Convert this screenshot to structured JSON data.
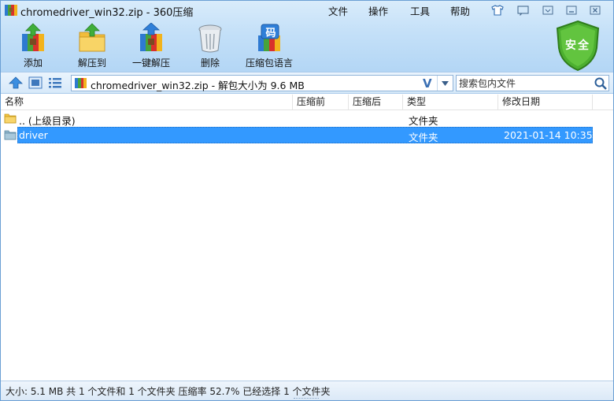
{
  "window": {
    "title": "chromedriver_win32.zip - 360压缩"
  },
  "menu": {
    "items": [
      "文件",
      "操作",
      "工具",
      "帮助"
    ]
  },
  "toolbar": {
    "buttons": [
      {
        "label": "添加",
        "icon": "add-archive-icon"
      },
      {
        "label": "解压到",
        "icon": "extract-to-icon"
      },
      {
        "label": "一键解压",
        "icon": "one-click-extract-icon"
      },
      {
        "label": "删除",
        "icon": "delete-trash-icon"
      },
      {
        "label": "压缩包语言",
        "icon": "archive-language-icon"
      }
    ],
    "language_glyph": "码",
    "security_badge": "安全"
  },
  "address": {
    "path": "chromedriver_win32.zip - 解包大小为 9.6 MB",
    "verify_glyph": "V",
    "search_placeholder": "搜索包内文件"
  },
  "columns": [
    "名称",
    "压缩前",
    "压缩后",
    "类型",
    "修改日期"
  ],
  "rows": [
    {
      "name": ".. (上级目录)",
      "before": "",
      "after": "",
      "type": "文件夹",
      "modified": "",
      "icon": "folder-up-icon",
      "selected": false
    },
    {
      "name": "driver",
      "before": "",
      "after": "",
      "type": "文件夹",
      "modified": "2021-01-14 10:35",
      "icon": "folder-icon",
      "selected": true
    }
  ],
  "status": {
    "text": "大小: 5.1 MB 共 1 个文件和 1 个文件夹 压缩率 52.7% 已经选择 1 个文件夹"
  },
  "colors": {
    "accent": "#3399ff",
    "shield_green": "#4caf30",
    "folder_yellow": "#f4c542"
  }
}
